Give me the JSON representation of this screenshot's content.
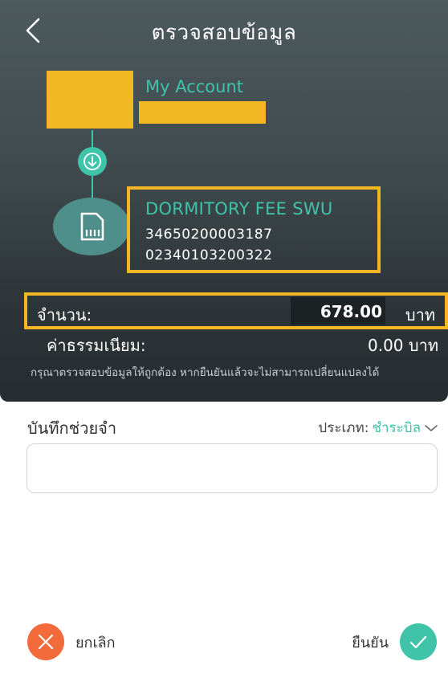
{
  "header": {
    "title": "ตรวจสอบข้อมูล",
    "back_icon": "chevron-left-icon"
  },
  "from_account": {
    "label": "My Account"
  },
  "to_account": {
    "name": "DORMITORY FEE SWU",
    "ref1": "34650200003187",
    "ref2": "02340103200322",
    "icon": "bill-icon"
  },
  "summary": {
    "amount_label": "จำนวน:",
    "amount_value": "678.00",
    "amount_unit": "บาท",
    "fee_label": "ค่าธรรมเนียม:",
    "fee_value": "0.00 บาท",
    "note": "กรุณาตรวจสอบข้อมูลให้ถูกต้อง หากยืนยันแล้วจะไม่สามารถเปลี่ยนแปลงได้"
  },
  "memo": {
    "label": "บันทึกช่วยจำ",
    "type_label": "ประเภท:",
    "type_value": "ชำระบิล",
    "input_value": "",
    "input_placeholder": ""
  },
  "actions": {
    "cancel_label": "ยกเลิก",
    "confirm_label": "ยืนยัน"
  },
  "colors": {
    "accent": "#3fc3a9",
    "highlight": "#f2b722",
    "cancel": "#f36a3b",
    "header_bg": "#3e494c"
  }
}
